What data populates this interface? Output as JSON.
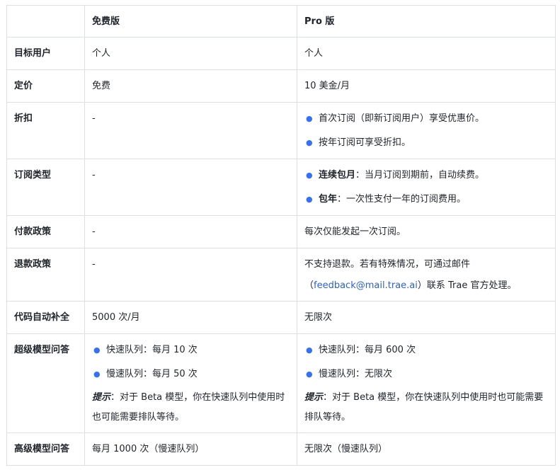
{
  "header": {
    "empty": "",
    "free": "免费版",
    "pro": "Pro 版"
  },
  "rows": {
    "target": {
      "label": "目标用户",
      "free": "个人",
      "pro": "个人"
    },
    "price": {
      "label": "定价",
      "free": "免费",
      "pro": "10 美金/月"
    },
    "discount": {
      "label": "折扣",
      "free": "-",
      "pro_items": [
        "首次订阅（即新订阅用户）享受优惠价。",
        "按年订阅可享受折扣。"
      ]
    },
    "subscription": {
      "label": "订阅类型",
      "free": "-",
      "pro_items": [
        {
          "bold": "连续包月",
          "rest": "：当月订阅到期前，自动续费。"
        },
        {
          "bold": "包年",
          "rest": "：一次性支付一年的订阅费用。"
        }
      ]
    },
    "payment": {
      "label": "付款政策",
      "free": "-",
      "pro": "每次仅能发起一次订阅。"
    },
    "refund": {
      "label": "退款政策",
      "free": "-",
      "pro_line1": "不支持退款。若有特殊情况，可通过邮件",
      "pro_paren_open": "（",
      "pro_email": "feedback@mail.trae.ai",
      "pro_line2_rest": "）联系 Trae 官方处理。"
    },
    "completion": {
      "label": "代码自动补全",
      "free": "5000 次/月",
      "pro": "无限次"
    },
    "super_model": {
      "label": "超级模型问答",
      "free_items": [
        "快速队列：每月 10 次",
        "慢速队列：每月 50 次"
      ],
      "pro_items": [
        "快速队列：每月 600 次",
        "慢速队列：无限次"
      ],
      "hint_label": "提示",
      "hint_text": "：对于 Beta 模型，你在快速队列中使用时也可能需要排队等待。"
    },
    "advanced_model": {
      "label": "高级模型问答",
      "free": "每月 1000 次（慢速队列）",
      "pro": "无限次（慢速队列）"
    }
  },
  "colors": {
    "border": "#dcdfe4",
    "bullet": "#3370ff",
    "link": "#2b5fd9",
    "text": "#1f2329"
  }
}
